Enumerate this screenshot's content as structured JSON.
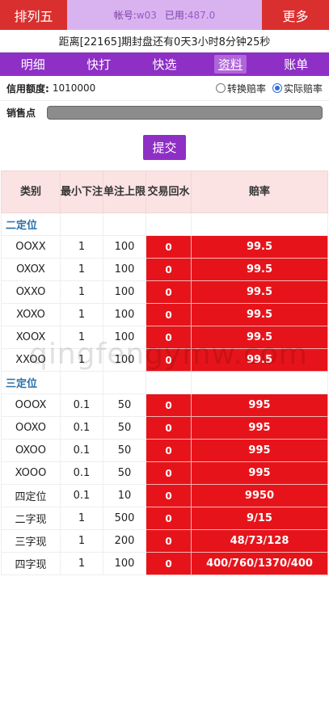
{
  "topbar": {
    "left_title": "排列五",
    "account_label": "帐号:",
    "account_value": "w03",
    "used_label": "已用:",
    "used_value": "487.0",
    "more_label": "更多"
  },
  "countdown": "距离[22165]期封盘还有0天3小时8分钟25秒",
  "nav": [
    "明细",
    "快打",
    "快选",
    "资料",
    "账单"
  ],
  "credit": {
    "label": "信用额度:",
    "value": "1010000",
    "radio_convert": "转换赔率",
    "radio_actual": "实际赔率"
  },
  "sales": {
    "label": "销售点"
  },
  "submit_label": "提交",
  "table": {
    "headers": [
      "类别",
      "最小下注",
      "单注上限",
      "交易回水",
      "赔率"
    ],
    "sections": [
      {
        "title": "二定位",
        "rows": [
          {
            "name": "OOXX",
            "min": "1",
            "max": "100",
            "ret": "0",
            "rate": "99.5"
          },
          {
            "name": "OXOX",
            "min": "1",
            "max": "100",
            "ret": "0",
            "rate": "99.5"
          },
          {
            "name": "OXXO",
            "min": "1",
            "max": "100",
            "ret": "0",
            "rate": "99.5"
          },
          {
            "name": "XOXO",
            "min": "1",
            "max": "100",
            "ret": "0",
            "rate": "99.5"
          },
          {
            "name": "XOOX",
            "min": "1",
            "max": "100",
            "ret": "0",
            "rate": "99.5"
          },
          {
            "name": "XXOO",
            "min": "1",
            "max": "100",
            "ret": "0",
            "rate": "99.5"
          }
        ]
      },
      {
        "title": "三定位",
        "rows": [
          {
            "name": "OOOX",
            "min": "0.1",
            "max": "50",
            "ret": "0",
            "rate": "995"
          },
          {
            "name": "OOXO",
            "min": "0.1",
            "max": "50",
            "ret": "0",
            "rate": "995"
          },
          {
            "name": "OXOO",
            "min": "0.1",
            "max": "50",
            "ret": "0",
            "rate": "995"
          },
          {
            "name": "XOOO",
            "min": "0.1",
            "max": "50",
            "ret": "0",
            "rate": "995"
          },
          {
            "name": "四定位",
            "min": "0.1",
            "max": "10",
            "ret": "0",
            "rate": "9950"
          },
          {
            "name": "二字现",
            "min": "1",
            "max": "500",
            "ret": "0",
            "rate": "9/15"
          },
          {
            "name": "三字现",
            "min": "1",
            "max": "200",
            "ret": "0",
            "rate": "48/73/128"
          },
          {
            "name": "四字现",
            "min": "1",
            "max": "100",
            "ret": "0",
            "rate": "400/760/1370/400"
          }
        ]
      }
    ]
  },
  "watermark": "qingfengymw.com",
  "colors": {
    "red": "#e6141a",
    "purple": "#8e2fc6",
    "header_red": "#d9302f"
  }
}
